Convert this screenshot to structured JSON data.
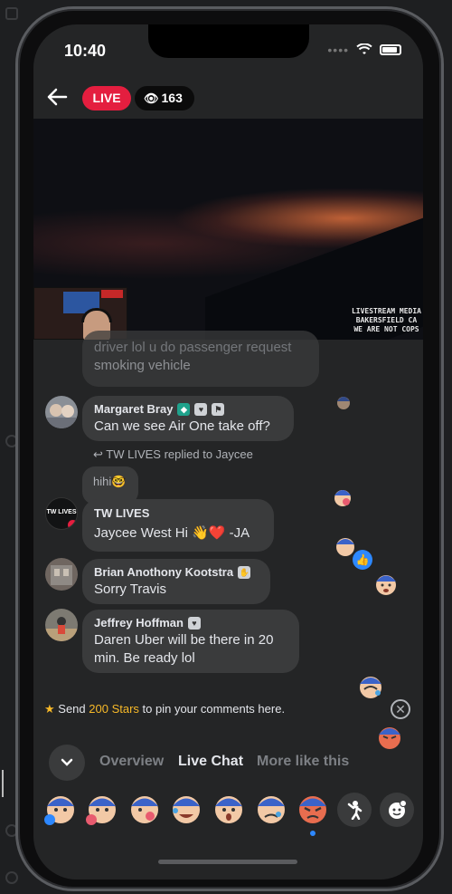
{
  "status": {
    "time": "10:40"
  },
  "header": {
    "live_label": "LIVE",
    "viewer_count": "163"
  },
  "video": {
    "watermark_lines": [
      "LIVESTREAM MEDIA",
      "BAKERSFIELD CA",
      "WE ARE NOT COPS"
    ]
  },
  "chat": {
    "partial_message": {
      "line1": "driver lol u do passenger request",
      "line2": "smoking vehicle"
    },
    "messages": [
      {
        "name": "Margaret Bray",
        "text": "Can we see Air One take off?"
      },
      {
        "reply_note": "TW LIVES replied to Jaycee",
        "quoted": "hihi🤓"
      },
      {
        "name": "TW LIVES",
        "text": "Jaycee West Hi 👋❤️ -JA"
      },
      {
        "name": "Brian Anothony Kootstra",
        "text": "Sorry Travis"
      },
      {
        "name": "Jeffrey Hoffman",
        "text": "Daren Uber will be there in 20 min. Be ready lol"
      }
    ],
    "avatar_caption": "TW LIVES"
  },
  "pin": {
    "prefix": "Send ",
    "stars": "200 Stars",
    "suffix": " to pin your comments here."
  },
  "tabs": {
    "overview": "Overview",
    "live_chat": "Live Chat",
    "more": "More like this"
  },
  "icons": [
    "back-arrow-icon",
    "eye-icon",
    "wifi-icon",
    "battery-icon",
    "reply-icon",
    "close-icon",
    "chevron-down-icon",
    "star-icon",
    "like-icon",
    "heart-icon",
    "cheer-icon",
    "sticker-icon"
  ],
  "colors": {
    "live_red": "#e41e3f",
    "stars_yellow": "#f7b928",
    "like_blue": "#2d88ff",
    "bubble": "#3a3b3c"
  }
}
